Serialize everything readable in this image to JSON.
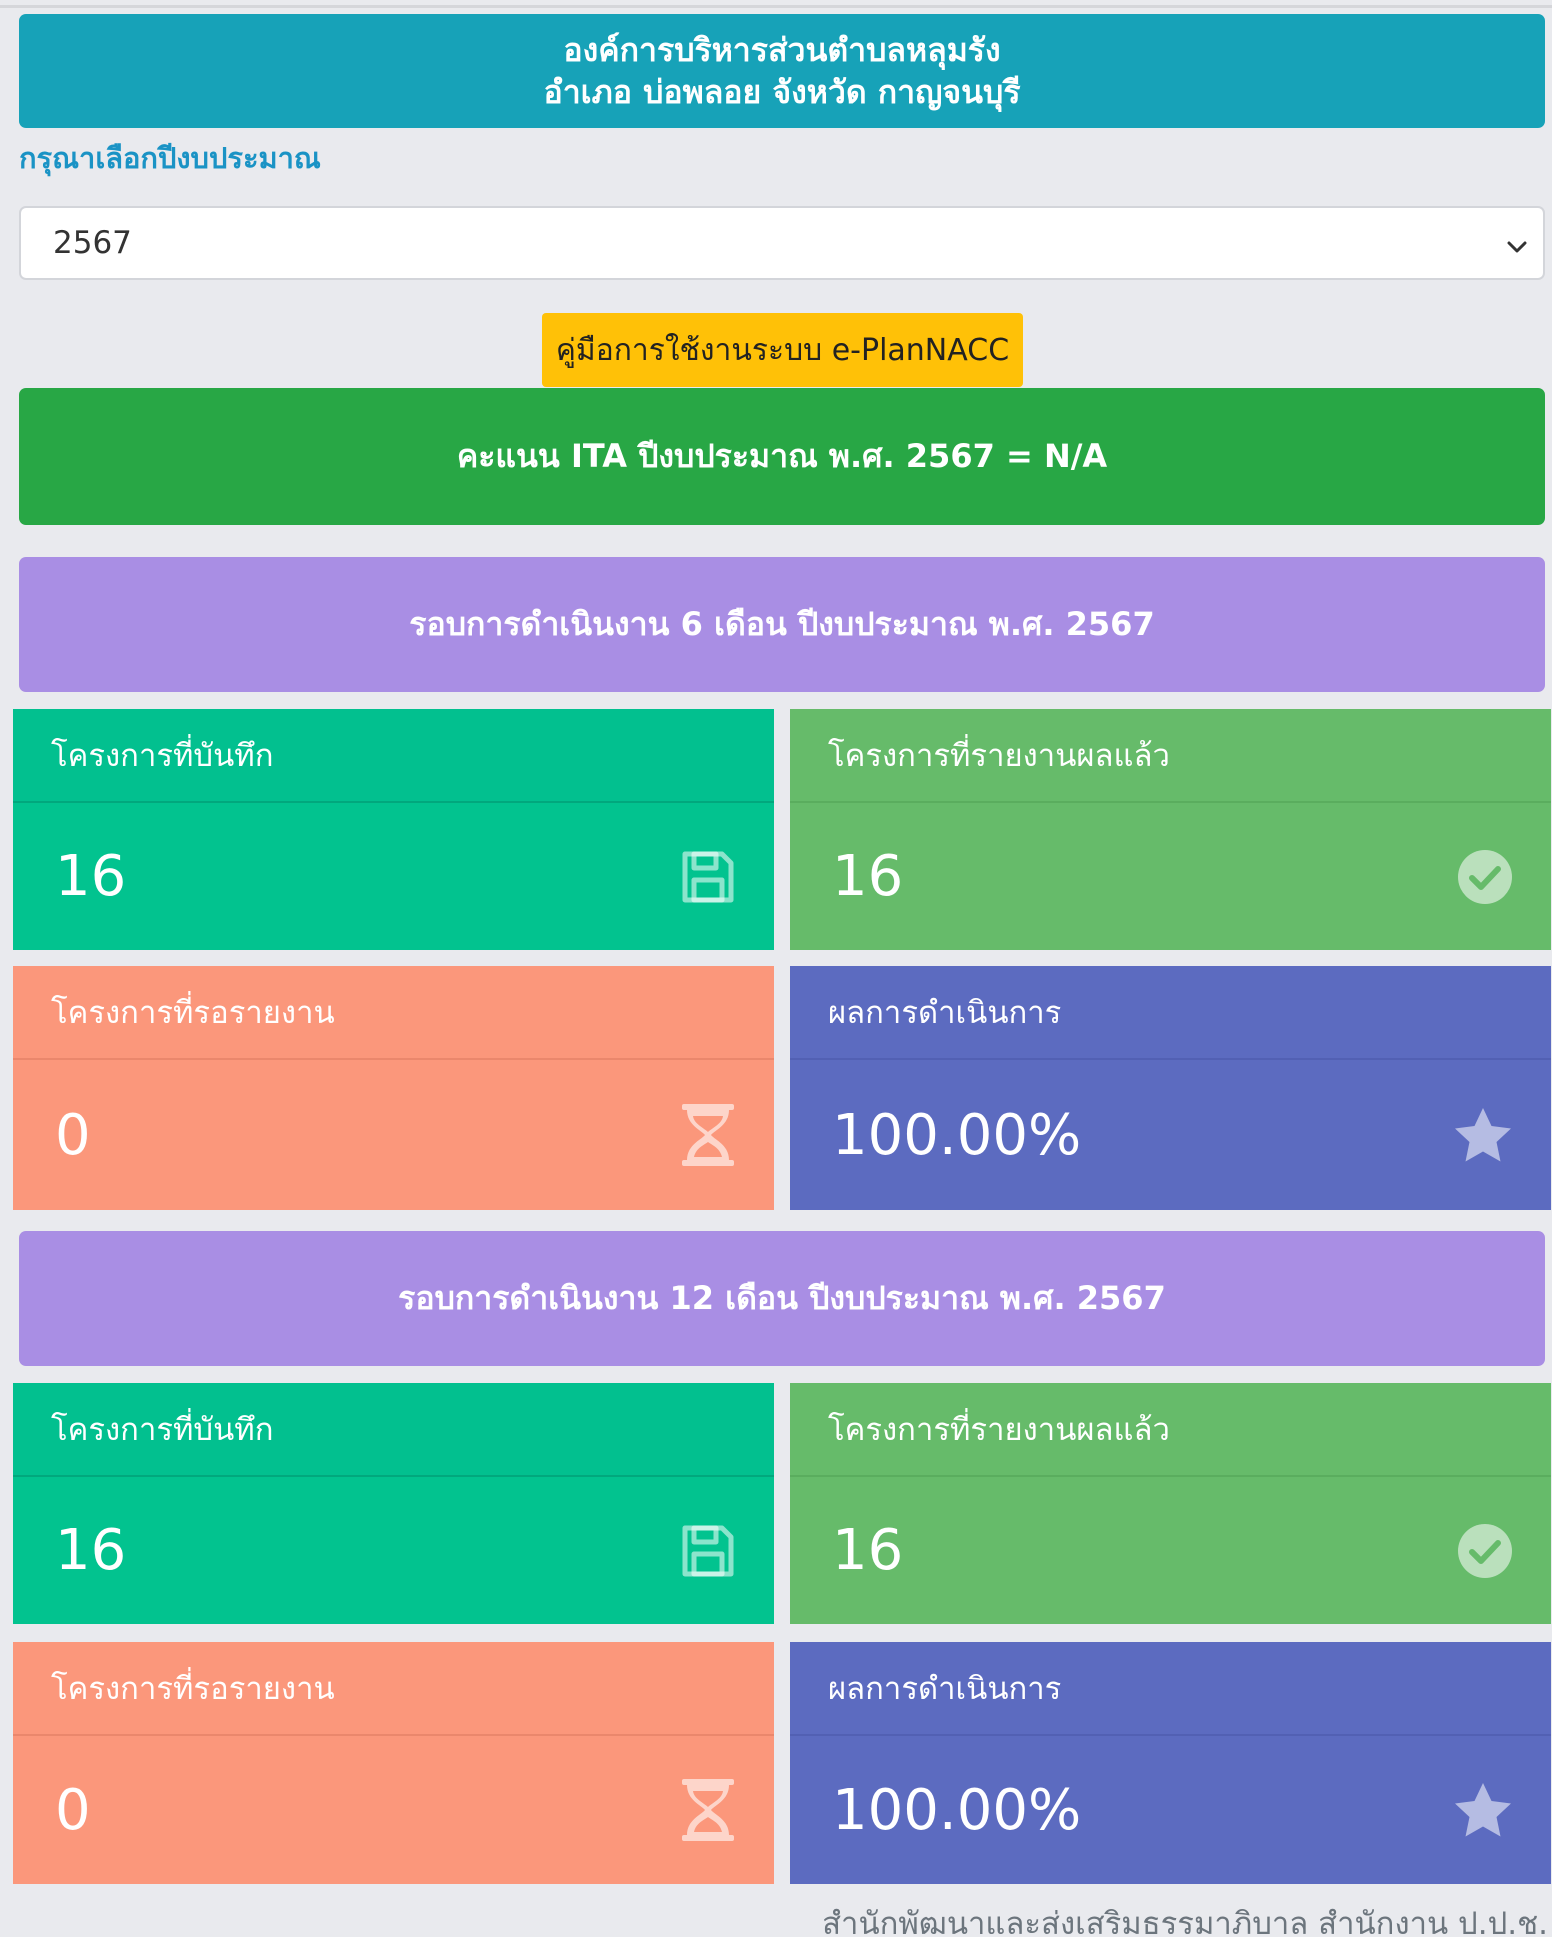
{
  "header": {
    "line1": "องค์การบริหารส่วนตำบลหลุมรัง",
    "line2": "อำเภอ บ่อพลอย จังหวัด กาญจนบุรี"
  },
  "year_select": {
    "label": "กรุณาเลือกปีงบประมาณ",
    "value": "2567"
  },
  "manual_button": "คู่มือการใช้งานระบบ e-PlanNACC",
  "ita_score": "คะแนน ITA ปีงบประมาณ พ.ศ. 2567 = N/A",
  "rounds": [
    {
      "title": "รอบการดำเนินงาน 6 เดือน ปีงบประมาณ พ.ศ. 2567",
      "recorded": {
        "label": "โครงการที่บันทึก",
        "value": "16"
      },
      "reported": {
        "label": "โครงการที่รายงานผลแล้ว",
        "value": "16"
      },
      "pending": {
        "label": "โครงการที่รอรายงาน",
        "value": "0"
      },
      "result": {
        "label": "ผลการดำเนินการ",
        "value": "100.00%"
      }
    },
    {
      "title": "รอบการดำเนินงาน 12 เดือน ปีงบประมาณ พ.ศ. 2567",
      "recorded": {
        "label": "โครงการที่บันทึก",
        "value": "16"
      },
      "reported": {
        "label": "โครงการที่รายงานผลแล้ว",
        "value": "16"
      },
      "pending": {
        "label": "โครงการที่รอรายงาน",
        "value": "0"
      },
      "result": {
        "label": "ผลการดำเนินการ",
        "value": "100.00%"
      }
    }
  ],
  "icons": {
    "recorded": "save-icon",
    "reported": "check-circle-icon",
    "pending": "hourglass-icon",
    "result": "star-icon"
  },
  "colors": {
    "header": "#17a2b8",
    "manual_button": "#ffc107",
    "ita": "#28a745",
    "round": "#a98ee4",
    "recorded": "#02c38f",
    "reported": "#66bb6a",
    "pending": "#fb977b",
    "result": "#5c6bc0"
  },
  "footer": "สำนักพัฒนาและส่งเสริมธรรมาภิบาล สำนักงาน ป.ป.ช."
}
